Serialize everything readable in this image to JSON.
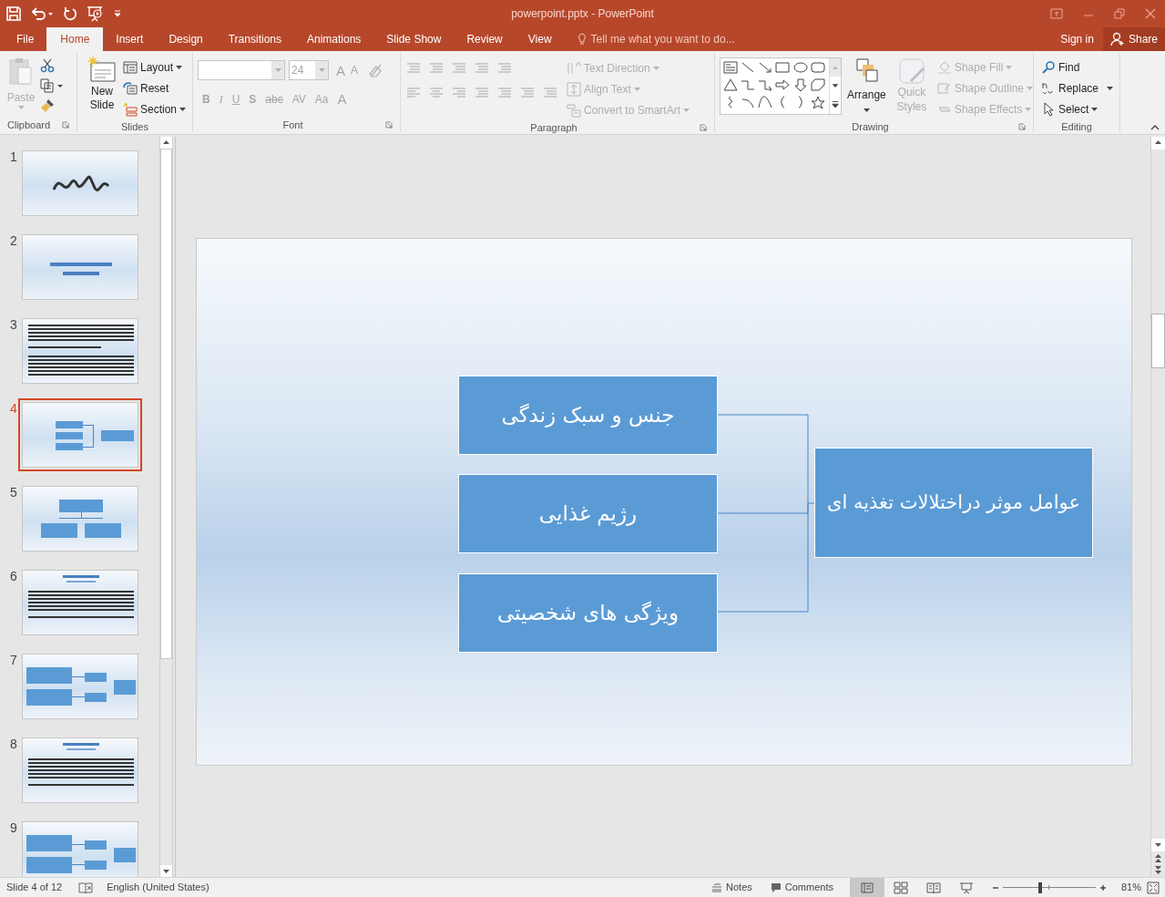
{
  "title_bar": {
    "title": "powerpoint.pptx - PowerPoint"
  },
  "tabs": [
    {
      "label": "File",
      "selected": false
    },
    {
      "label": "Home",
      "selected": true
    },
    {
      "label": "Insert",
      "selected": false
    },
    {
      "label": "Design",
      "selected": false
    },
    {
      "label": "Transitions",
      "selected": false
    },
    {
      "label": "Animations",
      "selected": false
    },
    {
      "label": "Slide Show",
      "selected": false
    },
    {
      "label": "Review",
      "selected": false
    },
    {
      "label": "View",
      "selected": false
    }
  ],
  "tell_me": {
    "placeholder": "Tell me what you want to do..."
  },
  "account": {
    "sign_in": "Sign in",
    "share": "Share"
  },
  "ribbon": {
    "clipboard": {
      "label": "Clipboard",
      "paste": {
        "label": "Paste",
        "disabled": true
      }
    },
    "slides": {
      "label": "Slides",
      "new_slide": {
        "label": "New Slide",
        "disabled": false
      },
      "layout": {
        "label": "Layout",
        "disabled": false
      },
      "reset": {
        "label": "Reset",
        "disabled": false
      },
      "section": {
        "label": "Section",
        "disabled": false
      }
    },
    "font": {
      "label": "Font",
      "disabled": true,
      "font_size": {
        "value": "24"
      },
      "size_buttons": [
        "A",
        "A"
      ],
      "format_buttons": [
        "B",
        "I",
        "U",
        "S",
        "abc",
        "AV",
        "Aa",
        "A"
      ]
    },
    "paragraph": {
      "label": "Paragraph",
      "disabled": true,
      "text_direction": {
        "label": "Text Direction",
        "disabled": true
      },
      "align_text": {
        "label": "Align Text",
        "disabled": true
      },
      "convert_smartart": {
        "label": "Convert to SmartArt",
        "disabled": true
      }
    },
    "drawing": {
      "label": "Drawing",
      "arrange": {
        "label": "Arrange",
        "disabled": false
      },
      "quick_styles": {
        "label": "Quick Styles",
        "disabled": true
      },
      "shape_fill": {
        "label": "Shape Fill",
        "disabled": true
      },
      "shape_outline": {
        "label": "Shape Outline",
        "disabled": true
      },
      "shape_effects": {
        "label": "Shape Effects",
        "disabled": true
      }
    },
    "editing": {
      "label": "Editing",
      "find": {
        "label": "Find",
        "disabled": false
      },
      "replace": {
        "label": "Replace",
        "disabled": false
      },
      "select": {
        "label": "Select",
        "disabled": false
      }
    }
  },
  "thumbnails": [
    {
      "number": "1",
      "selected": false,
      "kind": "calligraphy"
    },
    {
      "number": "2",
      "selected": false,
      "kind": "title"
    },
    {
      "number": "3",
      "selected": false,
      "kind": "text"
    },
    {
      "number": "4",
      "selected": true,
      "kind": "diagram-3to1"
    },
    {
      "number": "5",
      "selected": false,
      "kind": "org-chart"
    },
    {
      "number": "6",
      "selected": false,
      "kind": "text-title"
    },
    {
      "number": "7",
      "selected": false,
      "kind": "diagram-2"
    },
    {
      "number": "8",
      "selected": false,
      "kind": "text-title"
    },
    {
      "number": "9",
      "selected": false,
      "kind": "diagram-2"
    }
  ],
  "slide": {
    "left_boxes": [
      "جنس و سبک زندگی",
      "رژیم غذایی",
      "ویژگی های شخصیتی"
    ],
    "right_box": "عوامل موثر دراختلالات تغذیه ای"
  },
  "status_bar": {
    "slide_info": "Slide 4 of 12",
    "language": "English (United States)",
    "notes": "Notes",
    "comments": "Comments",
    "zoom": {
      "level": 0.4,
      "reading": "81%"
    }
  }
}
